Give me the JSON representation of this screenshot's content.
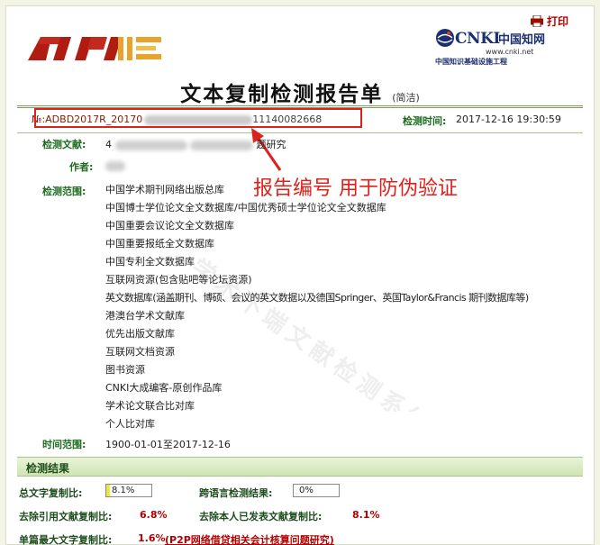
{
  "header": {
    "print_label": "打印",
    "cnki_brand": "CNKI",
    "cnki_cn": "中国知网",
    "cnki_url": "www.cnki.net",
    "cnki_subtitle": "中国知识基础设施工程"
  },
  "title": {
    "main": "文本复制检测报告单",
    "sub": "(简洁)"
  },
  "report": {
    "no_prefix": "№:ADBD2017R_20170",
    "no_tail": "11140082668",
    "check_time_label": "检测时间:",
    "check_time": "2017-12-16 19:30:59"
  },
  "doc": {
    "title_label": "检测文献:",
    "title_start": "4",
    "title_end": "题研究",
    "author_label": "作者:",
    "scope_label": "检测范围:",
    "scope": [
      "中国学术期刊网络出版总库",
      "中国博士学位论文全文数据库/中国优秀硕士学位论文全文数据库",
      "中国重要会议论文全文数据库",
      "中国重要报纸全文数据库",
      "中国专利全文数据库",
      "互联网资源(包含贴吧等论坛资源)",
      "英文数据库(涵盖期刊、博硕、会议的英文数据以及德国Springer、英国Taylor&Francis 期刊数据库等)",
      "港澳台学术文献库",
      "优先出版文献库",
      "互联网文档资源",
      "图书资源",
      "CNKI大成编客-原创作品库",
      "学术论文联合比对库",
      "个人比对库"
    ],
    "period_label": "时间范围:",
    "period": "1900-01-01至2017-12-16"
  },
  "annotation": "报告编号 用于防伪验证",
  "watermark": "学术不端文献检测系统",
  "results": {
    "header": "检测结果",
    "total_label": "总文字复制比:",
    "total_value": "8.1%",
    "total_fraction": 0.081,
    "cross_label": "跨语言检测结果:",
    "cross_value": "0%",
    "cross_fraction": 0.0,
    "excl_ref_label": "去除引用文献复制比:",
    "excl_ref_value": "6.8%",
    "excl_self_label": "去除本人已发表文献复制比:",
    "excl_self_value": "8.1%",
    "longest_label": "单篇最大文字复制比:",
    "longest_value": "1.6%",
    "longest_source": "(P2P网络借贷相关会计核算问题研究)"
  },
  "colors": {
    "label_green": "#1d6b1d",
    "value_red": "#b30000",
    "annotation_red": "#e0201a",
    "meter_yellow": "#f2e24a",
    "meter_green": "#8fd16a"
  }
}
